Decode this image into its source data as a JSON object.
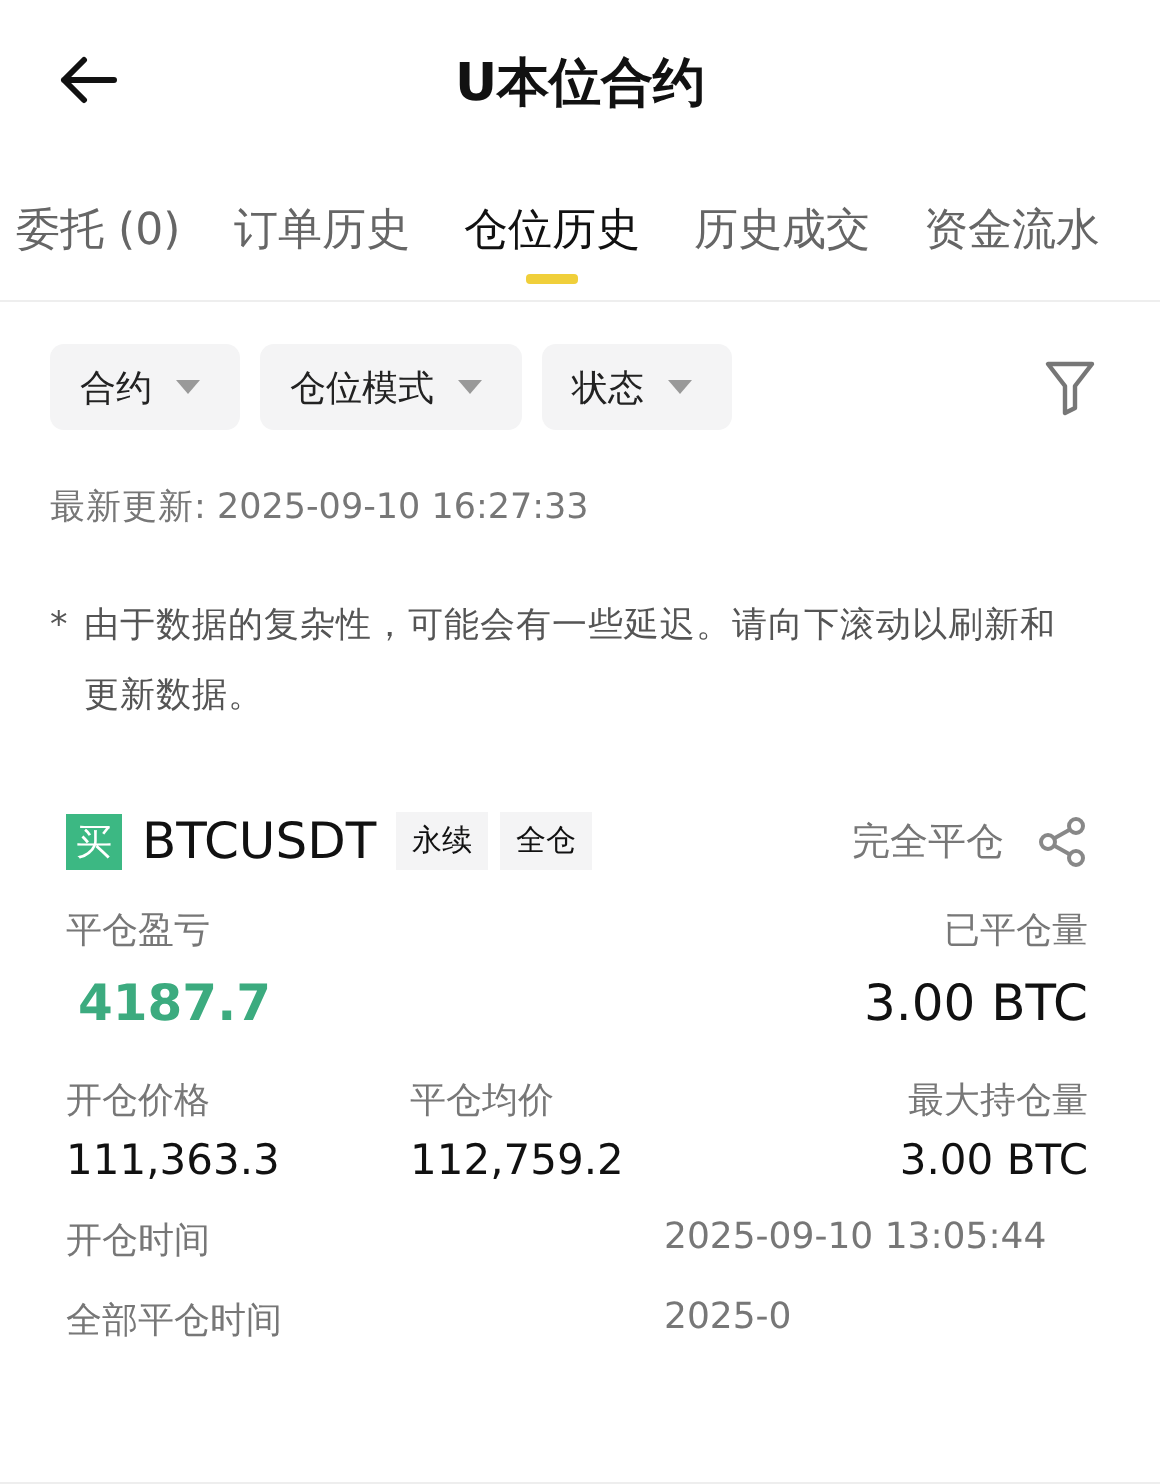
{
  "header": {
    "title": "U本位合约"
  },
  "tabs": [
    {
      "label": "委托 (0)",
      "selected": false
    },
    {
      "label": "订单历史",
      "selected": false
    },
    {
      "label": "仓位历史",
      "selected": true
    },
    {
      "label": "历史成交",
      "selected": false
    },
    {
      "label": "资金流水",
      "selected": false
    }
  ],
  "filters": [
    {
      "label": "合约"
    },
    {
      "label": "仓位模式"
    },
    {
      "label": "状态"
    }
  ],
  "last_updated": "最新更新: 2025-09-10 16:27:33",
  "notice": {
    "mark": "*",
    "text": "由于数据的复杂性，可能会有一些延迟。请向下滚动以刷新和更新数据。"
  },
  "position": {
    "side_badge": "买",
    "symbol": "BTCUSDT",
    "tags": [
      "永续",
      "全仓"
    ],
    "status": "完全平仓",
    "pnl_label": "平仓盈亏",
    "pnl_value": "4187.7",
    "closed_qty_label": "已平仓量",
    "closed_qty_value": "3.00  BTC",
    "stats": [
      {
        "label": "开仓价格",
        "value": "111,363.3"
      },
      {
        "label": "平仓均价",
        "value": "112,759.2"
      },
      {
        "label": "最大持仓量",
        "value": "3.00  BTC"
      }
    ],
    "times": [
      {
        "label": "开仓时间",
        "value": "2025-09-10 13:05:44"
      },
      {
        "label": "全部平仓时间",
        "value": "2025-0"
      }
    ]
  }
}
